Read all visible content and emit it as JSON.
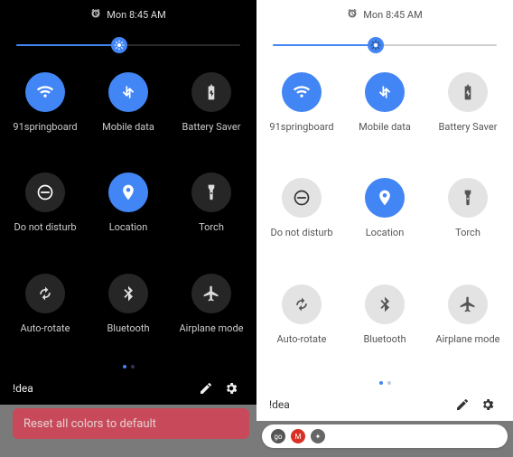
{
  "status": {
    "time": "Mon 8:45 AM"
  },
  "brightness": {
    "percent": 46
  },
  "tiles": [
    {
      "id": "wifi",
      "label": "91springboard",
      "active": true,
      "icon": "wifi"
    },
    {
      "id": "mobile-data",
      "label": "Mobile data",
      "active": true,
      "icon": "mobiledata"
    },
    {
      "id": "battery-saver",
      "label": "Battery Saver",
      "active": false,
      "icon": "battery"
    },
    {
      "id": "dnd",
      "label": "Do not disturb",
      "active": false,
      "icon": "dnd"
    },
    {
      "id": "location",
      "label": "Location",
      "active": true,
      "icon": "location"
    },
    {
      "id": "torch",
      "label": "Torch",
      "active": false,
      "icon": "torch"
    },
    {
      "id": "auto-rotate",
      "label": "Auto-rotate",
      "active": false,
      "icon": "rotate"
    },
    {
      "id": "bluetooth",
      "label": "Bluetooth",
      "active": false,
      "icon": "bluetooth"
    },
    {
      "id": "airplane",
      "label": "Airplane mode",
      "active": false,
      "icon": "airplane"
    }
  ],
  "pager": {
    "pages": 2,
    "current": 0
  },
  "footer": {
    "carrier": "!dea"
  },
  "backdrop": {
    "reset_label": "Reset all colors to default"
  },
  "notif_icons": [
    {
      "bg": "#555",
      "glyph": "go"
    },
    {
      "bg": "#d93025",
      "glyph": "M"
    },
    {
      "bg": "#666",
      "glyph": "✦"
    }
  ],
  "colors": {
    "accent": "#4285f4"
  }
}
